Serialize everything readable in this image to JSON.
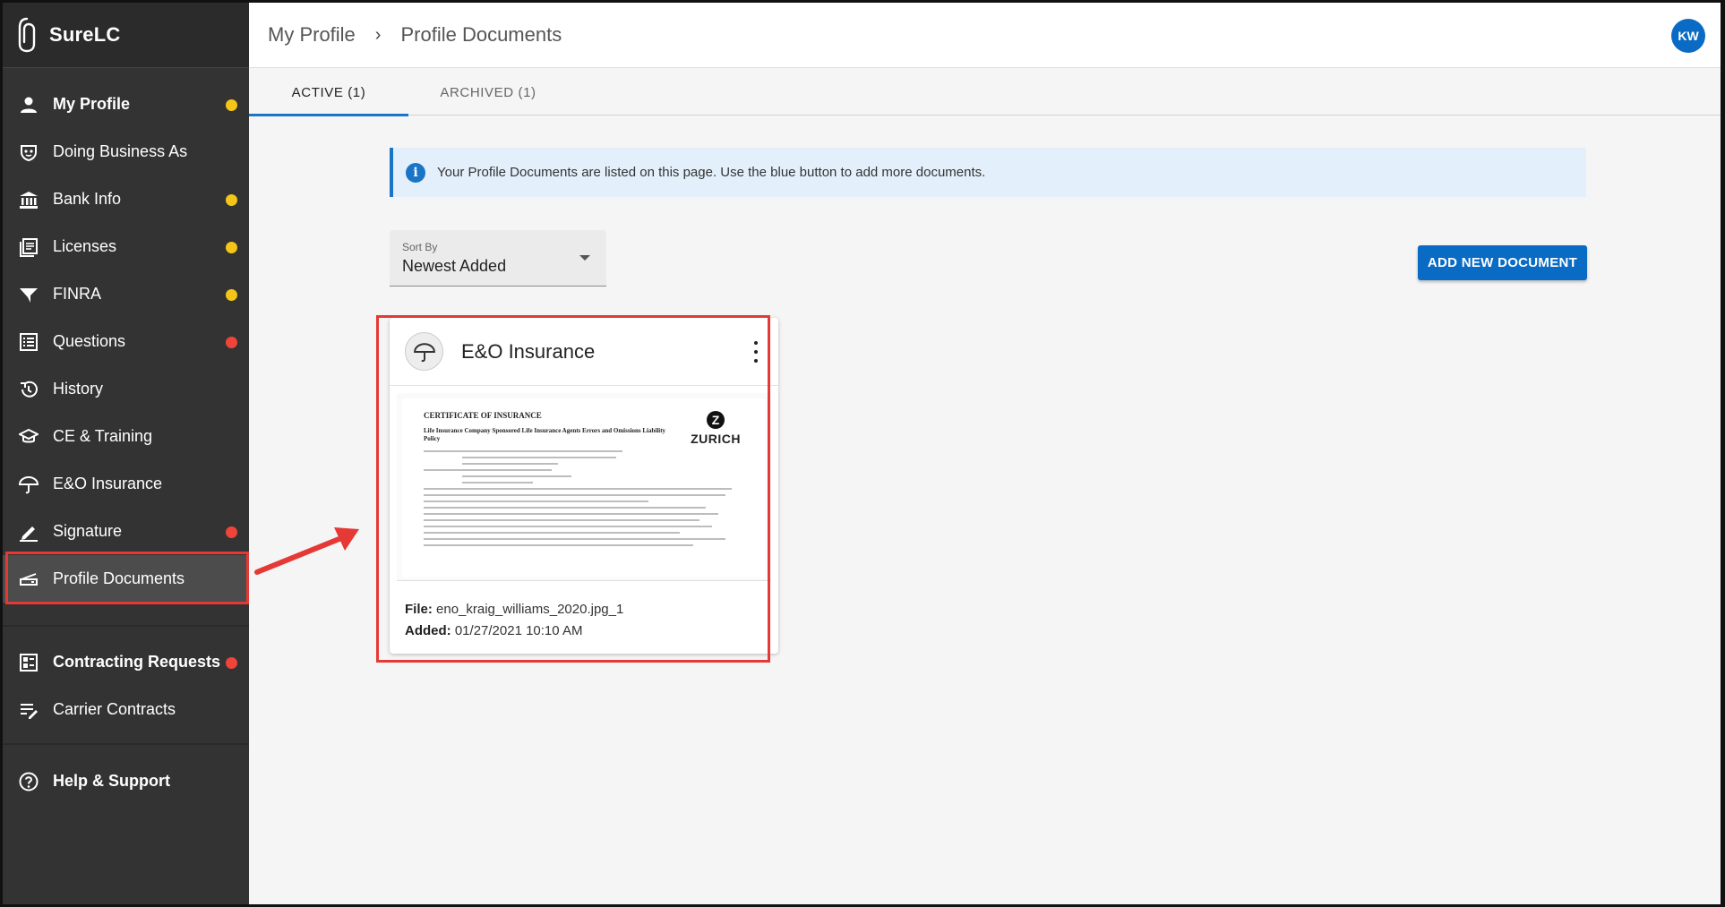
{
  "app": {
    "name": "SureLC"
  },
  "sidebar": {
    "items": [
      {
        "label": "My Profile",
        "icon": "person-icon",
        "dot": "yellow",
        "bold": true
      },
      {
        "label": "Doing Business As",
        "icon": "mask-icon",
        "dot": null,
        "bold": false
      },
      {
        "label": "Bank Info",
        "icon": "bank-icon",
        "dot": "yellow",
        "bold": false
      },
      {
        "label": "Licenses",
        "icon": "licenses-icon",
        "dot": "yellow",
        "bold": false
      },
      {
        "label": "FINRA",
        "icon": "finra-icon",
        "dot": "yellow",
        "bold": false
      },
      {
        "label": "Questions",
        "icon": "list-icon",
        "dot": "red",
        "bold": false
      },
      {
        "label": "History",
        "icon": "history-icon",
        "dot": null,
        "bold": false
      },
      {
        "label": "CE & Training",
        "icon": "graduation-cap-icon",
        "dot": null,
        "bold": false
      },
      {
        "label": "E&O Insurance",
        "icon": "umbrella-icon",
        "dot": null,
        "bold": false
      },
      {
        "label": "Signature",
        "icon": "pen-icon",
        "dot": "red",
        "bold": false
      },
      {
        "label": "Profile Documents",
        "icon": "scanner-icon",
        "dot": null,
        "bold": false,
        "active": true
      }
    ],
    "group2": [
      {
        "label": "Contracting Requests",
        "icon": "dashboard-icon",
        "dot": "red",
        "bold": true
      },
      {
        "label": "Carrier Contracts",
        "icon": "edit-list-icon",
        "dot": null,
        "bold": false
      }
    ],
    "group3": [
      {
        "label": "Help & Support",
        "icon": "help-icon",
        "dot": null,
        "bold": true
      }
    ]
  },
  "header": {
    "breadcrumb": [
      "My Profile",
      "Profile Documents"
    ],
    "avatar_initials": "KW"
  },
  "tabs": [
    {
      "label": "ACTIVE (1)",
      "active": true
    },
    {
      "label": "ARCHIVED (1)",
      "active": false
    }
  ],
  "info_banner": {
    "message": "Your Profile Documents are listed on this page. Use the blue button to add more documents."
  },
  "sort": {
    "label": "Sort By",
    "value": "Newest Added"
  },
  "add_button": {
    "label": "ADD NEW DOCUMENT"
  },
  "document_card": {
    "title": "E&O Insurance",
    "preview": {
      "heading": "CERTIFICATE OF INSURANCE",
      "subheading": "Life Insurance Company Sponsored Life Insurance Agents Errors and Omissions Liability Policy",
      "brand": "ZURICH",
      "brand_mark": "Z"
    },
    "file_label": "File:",
    "file_value": "eno_kraig_williams_2020.jpg_1",
    "added_label": "Added:",
    "added_value": "01/27/2021 10:10 AM"
  },
  "colors": {
    "sidebar_bg": "#333333",
    "accent_blue": "#0a6bc4",
    "dot_yellow": "#f5c518",
    "dot_red": "#f0443a",
    "highlight_red": "#e53935"
  }
}
